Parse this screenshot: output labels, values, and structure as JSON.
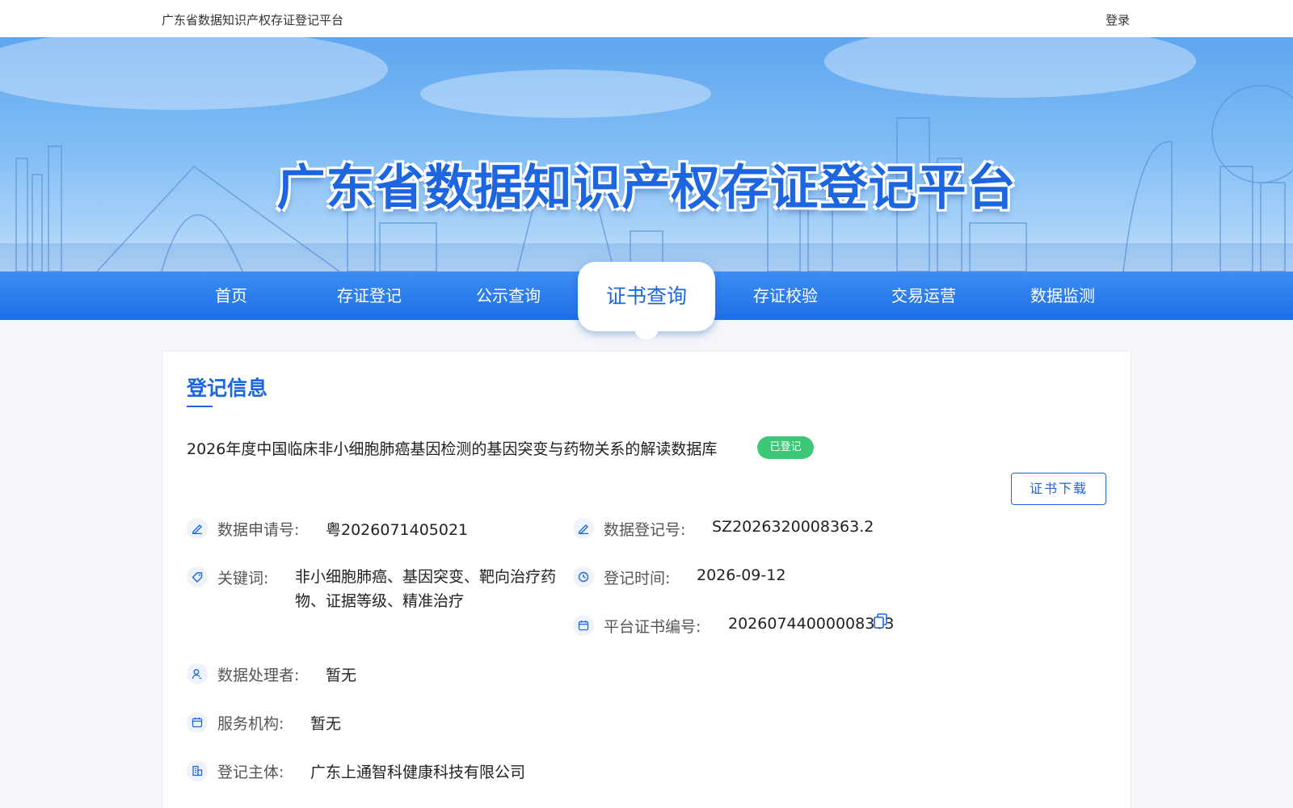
{
  "header": {
    "site_title": "广东省数据知识产权存证登记平台",
    "login": "登录"
  },
  "banner": {
    "title": "广东省数据知识产权存证登记平台"
  },
  "nav": {
    "items": [
      {
        "label": "首页"
      },
      {
        "label": "存证登记"
      },
      {
        "label": "公示查询"
      },
      {
        "label": "证书查询",
        "active": true
      },
      {
        "label": "存证校验"
      },
      {
        "label": "交易运营"
      },
      {
        "label": "数据监测"
      }
    ]
  },
  "record": {
    "section_title": "登记信息",
    "title": "2026年度中国临床非小细胞肺癌基因检测的基因突变与药物关系的解读数据库",
    "status": "已登记",
    "download_label": "证书下载",
    "fields": {
      "application_no": {
        "label": "数据申请号:",
        "value": "粤2026071405021",
        "icon": "edit-icon"
      },
      "registration_no": {
        "label": "数据登记号:",
        "value": "SZ2026320008363.2",
        "icon": "edit-icon"
      },
      "keywords": {
        "label": "关键词:",
        "value": "非小细胞肺癌、基因突变、靶向治疗药物、证据等级、精准治疗",
        "icon": "tag-icon"
      },
      "registration_time": {
        "label": "登记时间:",
        "value": "2026-09-12",
        "icon": "clock-icon"
      },
      "certificate_no": {
        "label": "平台证书编号:",
        "value": "20260744000008363",
        "icon": "calendar-icon"
      },
      "processor": {
        "label": "数据处理者:",
        "value": "暂无",
        "icon": "user-icon"
      },
      "service_org": {
        "label": "服务机构:",
        "value": "暂无",
        "icon": "calendar-icon"
      },
      "subject": {
        "label": "登记主体:",
        "value": "广东上通智科健康科技有限公司",
        "icon": "building-icon"
      }
    }
  },
  "colors": {
    "primary": "#1d66e0",
    "badge": "#3cc876"
  }
}
